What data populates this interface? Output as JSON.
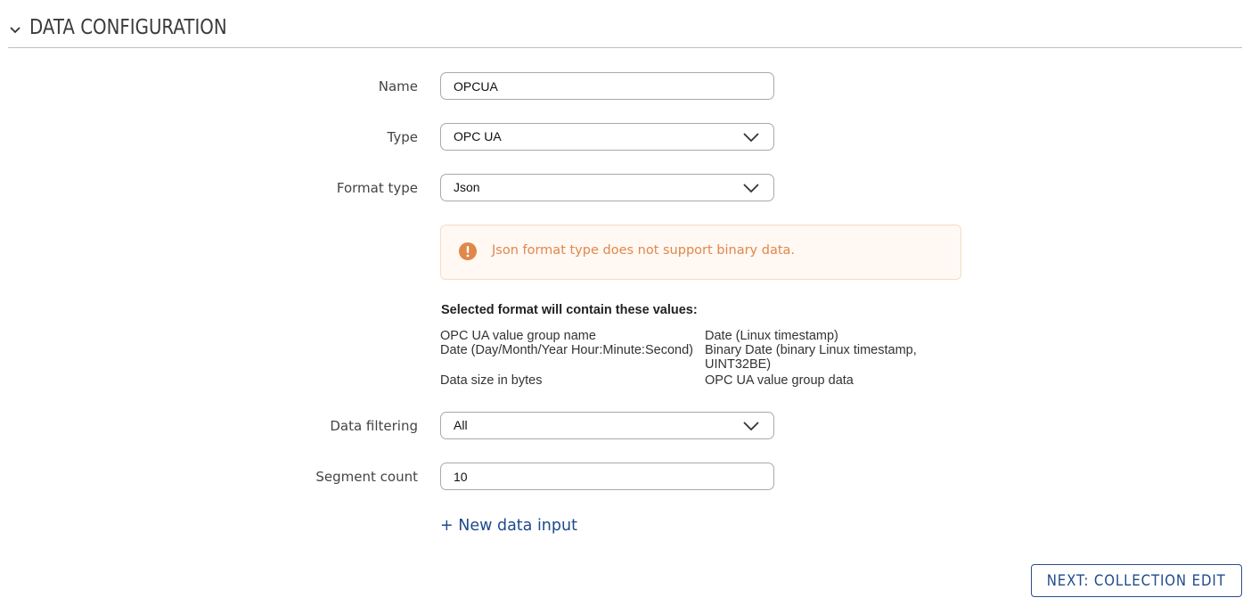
{
  "section": {
    "title": "DATA CONFIGURATION"
  },
  "form": {
    "name": {
      "label": "Name",
      "value": "OPCUA"
    },
    "type": {
      "label": "Type",
      "value": "OPC UA"
    },
    "format_type": {
      "label": "Format type",
      "value": "Json"
    },
    "data_filtering": {
      "label": "Data filtering",
      "value": "All"
    },
    "segment_count": {
      "label": "Segment count",
      "value": "10"
    }
  },
  "warning": {
    "text": "Json format type does not support binary data."
  },
  "values": {
    "title": "Selected format will contain these values:",
    "rows": [
      [
        "OPC UA value group name",
        "Date (Linux timestamp)"
      ],
      [
        "Date (Day/Month/Year Hour:Minute:Second)",
        "Binary Date (binary Linux timestamp,"
      ],
      [
        "",
        "UINT32BE)"
      ],
      [
        "Data size in bytes",
        "OPC UA value group data"
      ]
    ]
  },
  "actions": {
    "add_input": "+ New data input",
    "next": "NEXT: COLLECTION EDIT"
  },
  "colors": {
    "accent": "#1f4a8c",
    "warning": "#e0884a",
    "warning_bg": "#fff8f3"
  }
}
